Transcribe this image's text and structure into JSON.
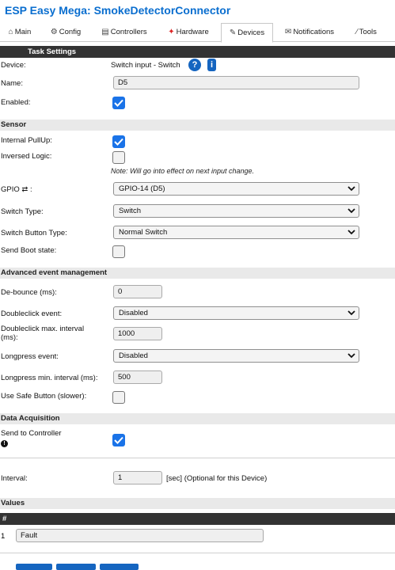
{
  "header": {
    "title": "ESP Easy Mega: SmokeDetectorConnector"
  },
  "tabs": [
    {
      "label": "Main",
      "icon": "home-icon"
    },
    {
      "label": "Config",
      "icon": "gear-icon"
    },
    {
      "label": "Controllers",
      "icon": "controller-icon"
    },
    {
      "label": "Hardware",
      "icon": "pin-icon"
    },
    {
      "label": "Devices",
      "icon": "plug-icon"
    },
    {
      "label": "Notifications",
      "icon": "mail-icon"
    },
    {
      "label": "Tools",
      "icon": "wrench-icon"
    }
  ],
  "active_tab": "Devices",
  "task_settings": {
    "header": "Task Settings",
    "device_label": "Device:",
    "device_value": "Switch input - Switch",
    "help_glyph": "?",
    "info_glyph": "i",
    "name_label": "Name:",
    "name_value": "D5",
    "enabled_label": "Enabled:",
    "enabled": true
  },
  "sensor": {
    "header": "Sensor",
    "pullup_label": "Internal PullUp:",
    "pullup": true,
    "inversed_label": "Inversed Logic:",
    "inversed": false,
    "note": "Note: Will go into effect on next input change.",
    "gpio_label": "GPIO ⇄ :",
    "gpio_value": "GPIO-14 (D5)",
    "switch_type_label": "Switch Type:",
    "switch_type_value": "Switch",
    "switch_button_label": "Switch Button Type:",
    "switch_button_value": "Normal Switch",
    "boot_state_label": "Send Boot state:",
    "boot_state": false
  },
  "advanced": {
    "header": "Advanced event management",
    "debounce_label": "De-bounce (ms):",
    "debounce_value": "0",
    "doubleclick_label": "Doubleclick event:",
    "doubleclick_value": "Disabled",
    "dc_interval_label": "Doubleclick max. interval (ms):",
    "dc_interval_value": "1000",
    "longpress_label": "Longpress event:",
    "longpress_value": "Disabled",
    "lp_interval_label": "Longpress min. interval (ms):",
    "lp_interval_value": "500",
    "safe_button_label": "Use Safe Button (slower):",
    "safe_button": false
  },
  "data_acquisition": {
    "header": "Data Acquisition",
    "send_label": "Send to Controller",
    "send_info_glyph": "!",
    "send": true,
    "interval_label": "Interval:",
    "interval_value": "1",
    "interval_suffix": "[sec] (Optional for this Device)"
  },
  "values": {
    "header": "Values",
    "col_header": "#",
    "rows": [
      {
        "index": "1",
        "name": "Fault"
      }
    ]
  },
  "colors": {
    "title": "#0a6ecf",
    "checkbox": "#1a73e8",
    "dark_header": "#333333",
    "section_header": "#e9e9e9",
    "badge": "#1565c0"
  }
}
